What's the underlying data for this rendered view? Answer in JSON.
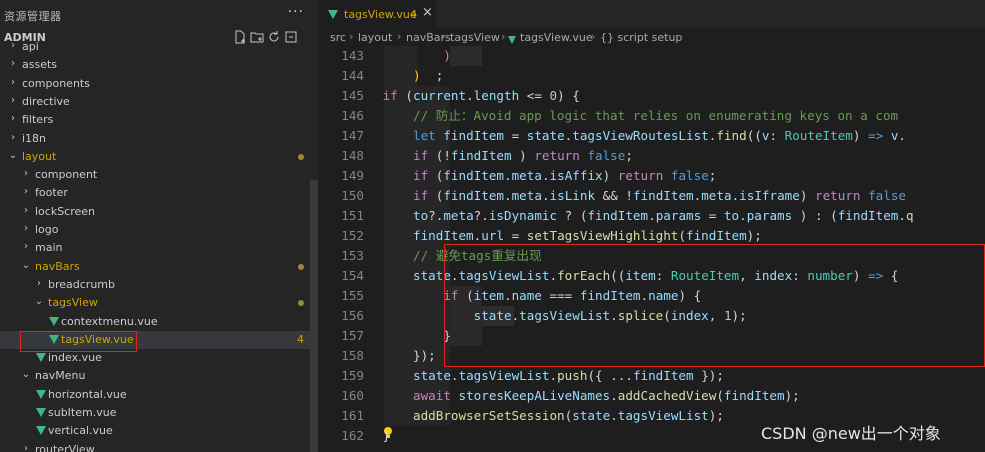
{
  "sidebar": {
    "title": "资源管理器",
    "more": "···",
    "root": "ADMIN",
    "actions": [
      "new-file-icon",
      "new-folder-icon",
      "refresh-icon",
      "collapse-icon"
    ],
    "items": [
      {
        "label": "api",
        "depth": 0,
        "expanded": false
      },
      {
        "label": "assets",
        "depth": 0,
        "expanded": false
      },
      {
        "label": "components",
        "depth": 0,
        "expanded": false
      },
      {
        "label": "directive",
        "depth": 0,
        "expanded": false
      },
      {
        "label": "filters",
        "depth": 0,
        "expanded": false
      },
      {
        "label": "i18n",
        "depth": 0,
        "expanded": false
      },
      {
        "label": "layout",
        "depth": 0,
        "expanded": true,
        "modified": true
      },
      {
        "label": "component",
        "depth": 1,
        "expanded": false
      },
      {
        "label": "footer",
        "depth": 1,
        "expanded": false
      },
      {
        "label": "lockScreen",
        "depth": 1,
        "expanded": false
      },
      {
        "label": "logo",
        "depth": 1,
        "expanded": false
      },
      {
        "label": "main",
        "depth": 1,
        "expanded": false
      },
      {
        "label": "navBars",
        "depth": 1,
        "expanded": true,
        "modified": true
      },
      {
        "label": "breadcrumb",
        "depth": 2,
        "expanded": false
      },
      {
        "label": "tagsView",
        "depth": 2,
        "expanded": true,
        "modified": true
      },
      {
        "label": "contextmenu.vue",
        "depth": 3,
        "file": true
      },
      {
        "label": "tagsView.vue",
        "depth": 3,
        "file": true,
        "selected": true,
        "badge": "4"
      },
      {
        "label": "index.vue",
        "depth": 2,
        "file": true
      },
      {
        "label": "navMenu",
        "depth": 1,
        "expanded": true
      },
      {
        "label": "horizontal.vue",
        "depth": 2,
        "file": true
      },
      {
        "label": "subItem.vue",
        "depth": 2,
        "file": true
      },
      {
        "label": "vertical.vue",
        "depth": 2,
        "file": true
      },
      {
        "label": "routerView",
        "depth": 1,
        "expanded": false
      }
    ]
  },
  "editor": {
    "tab": {
      "label": "tagsView.vue",
      "count": "4",
      "close": "×"
    },
    "breadcrumbs": [
      "src",
      "layout",
      "navBars",
      "tagsView",
      "tagsView.vue",
      "{} script setup"
    ],
    "line_numbers": [
      "143",
      "144",
      "145",
      "146",
      "147",
      "148",
      "149",
      "150",
      "151",
      "152",
      "153",
      "154",
      "155",
      "156",
      "157",
      "158",
      "159",
      "160",
      "161",
      "162"
    ],
    "lines": [
      [
        [
          "p",
          "                )"
        ]
      ],
      [
        [
          "p1",
          "            )"
        ],
        [
          "",
          "  ;"
        ]
      ],
      [
        [
          "k",
          "        if"
        ],
        [
          "",
          " ("
        ],
        [
          "v",
          "current"
        ],
        [
          "",
          "."
        ],
        [
          "v",
          "length"
        ],
        [
          "",
          " <= "
        ],
        [
          "n",
          "0"
        ],
        [
          "",
          ") {"
        ]
      ],
      [
        [
          "c",
          "            // 防止：Avoid app logic that relies on enumerating keys on a com"
        ]
      ],
      [
        [
          "b",
          "            let"
        ],
        [
          "",
          " "
        ],
        [
          "v",
          "findItem"
        ],
        [
          "",
          " = "
        ],
        [
          "v",
          "state"
        ],
        [
          "",
          "."
        ],
        [
          "v",
          "tagsViewRoutesList"
        ],
        [
          "",
          "."
        ],
        [
          "f",
          "find"
        ],
        [
          "",
          "(("
        ],
        [
          "v",
          "v"
        ],
        [
          "",
          ": "
        ],
        [
          "t",
          "RouteItem"
        ],
        [
          "",
          ") "
        ],
        [
          "b",
          "=>"
        ],
        [
          "",
          " "
        ],
        [
          "v",
          "v"
        ],
        [
          "",
          "."
        ]
      ],
      [
        [
          "k",
          "            if"
        ],
        [
          "",
          " (!"
        ],
        [
          "v",
          "findItem"
        ],
        [
          "",
          " ) "
        ],
        [
          "k",
          "return"
        ],
        [
          "",
          " "
        ],
        [
          "b",
          "false"
        ],
        [
          "",
          ";"
        ]
      ],
      [
        [
          "k",
          "            if"
        ],
        [
          "",
          " ("
        ],
        [
          "v",
          "findItem"
        ],
        [
          "",
          "."
        ],
        [
          "v",
          "meta"
        ],
        [
          "",
          "."
        ],
        [
          "v",
          "isAffix"
        ],
        [
          "",
          ") "
        ],
        [
          "k",
          "return"
        ],
        [
          "",
          " "
        ],
        [
          "b",
          "false"
        ],
        [
          "",
          ";"
        ]
      ],
      [
        [
          "k",
          "            if"
        ],
        [
          "",
          " ("
        ],
        [
          "v",
          "findItem"
        ],
        [
          "",
          "."
        ],
        [
          "v",
          "meta"
        ],
        [
          "",
          "."
        ],
        [
          "v",
          "isLink"
        ],
        [
          "",
          " && !"
        ],
        [
          "v",
          "findItem"
        ],
        [
          "",
          "."
        ],
        [
          "v",
          "meta"
        ],
        [
          "",
          "."
        ],
        [
          "v",
          "isIframe"
        ],
        [
          "",
          ") "
        ],
        [
          "k",
          "return"
        ],
        [
          "",
          " "
        ],
        [
          "b",
          "false"
        ]
      ],
      [
        [
          "v",
          "            to"
        ],
        [
          "",
          "?."
        ],
        [
          "v",
          "meta"
        ],
        [
          "",
          "?."
        ],
        [
          "v",
          "isDynamic"
        ],
        [
          "",
          " ? ("
        ],
        [
          "v",
          "findItem"
        ],
        [
          "",
          "."
        ],
        [
          "v",
          "params"
        ],
        [
          "",
          " = "
        ],
        [
          "v",
          "to"
        ],
        [
          "",
          "."
        ],
        [
          "v",
          "params"
        ],
        [
          "",
          " ) : ("
        ],
        [
          "v",
          "findItem"
        ],
        [
          "",
          ".q"
        ]
      ],
      [
        [
          "v",
          "            findItem"
        ],
        [
          "",
          "."
        ],
        [
          "v",
          "url"
        ],
        [
          "",
          " = "
        ],
        [
          "f",
          "setTagsViewHighlight"
        ],
        [
          "",
          "("
        ],
        [
          "v",
          "findItem"
        ],
        [
          "",
          ");"
        ]
      ],
      [
        [
          "c",
          "            // 避免tags重复出现"
        ]
      ],
      [
        [
          "v",
          "            state"
        ],
        [
          "",
          "."
        ],
        [
          "v",
          "tagsViewList"
        ],
        [
          "",
          "."
        ],
        [
          "f",
          "forEach"
        ],
        [
          "",
          "(("
        ],
        [
          "v",
          "item"
        ],
        [
          "",
          ": "
        ],
        [
          "t",
          "RouteItem"
        ],
        [
          "",
          ", "
        ],
        [
          "v",
          "index"
        ],
        [
          "",
          ": "
        ],
        [
          "t",
          "number"
        ],
        [
          "",
          ") "
        ],
        [
          "b",
          "=>"
        ],
        [
          "",
          " {"
        ]
      ],
      [
        [
          "k",
          "                if"
        ],
        [
          "",
          " ("
        ],
        [
          "v",
          "item"
        ],
        [
          "",
          "."
        ],
        [
          "v",
          "name"
        ],
        [
          "",
          " === "
        ],
        [
          "v",
          "findItem"
        ],
        [
          "",
          "."
        ],
        [
          "v",
          "name"
        ],
        [
          "",
          ") {"
        ]
      ],
      [
        [
          "v",
          "                    state"
        ],
        [
          "",
          "."
        ],
        [
          "v",
          "tagsViewList"
        ],
        [
          "",
          "."
        ],
        [
          "f",
          "splice"
        ],
        [
          "",
          "("
        ],
        [
          "v",
          "index"
        ],
        [
          "",
          ", "
        ],
        [
          "n",
          "1"
        ],
        [
          "",
          ");"
        ]
      ],
      [
        [
          "",
          "                }"
        ]
      ],
      [
        [
          "",
          "            });"
        ]
      ],
      [
        [
          "v",
          "            state"
        ],
        [
          "",
          "."
        ],
        [
          "v",
          "tagsViewList"
        ],
        [
          "",
          "."
        ],
        [
          "f",
          "push"
        ],
        [
          "",
          "({ ..."
        ],
        [
          "v",
          "findItem"
        ],
        [
          "",
          " });"
        ]
      ],
      [
        [
          "k",
          "            await"
        ],
        [
          "",
          " "
        ],
        [
          "v",
          "storesKeepALiveNames"
        ],
        [
          "",
          "."
        ],
        [
          "f",
          "addCachedView"
        ],
        [
          "",
          "("
        ],
        [
          "v",
          "findItem"
        ],
        [
          "",
          ");"
        ]
      ],
      [
        [
          "f",
          "            addBrowserSetSession"
        ],
        [
          "",
          "("
        ],
        [
          "v",
          "state"
        ],
        [
          "",
          "."
        ],
        [
          "v",
          "tagsViewList"
        ],
        [
          "",
          ");"
        ]
      ],
      [
        [
          "",
          "        }"
        ]
      ]
    ]
  },
  "watermark": "CSDN @new出一个对象",
  "colors": {
    "accent_modified": "#cca700",
    "vue_green": "#41b883",
    "highlight_box": "#e0251b"
  }
}
